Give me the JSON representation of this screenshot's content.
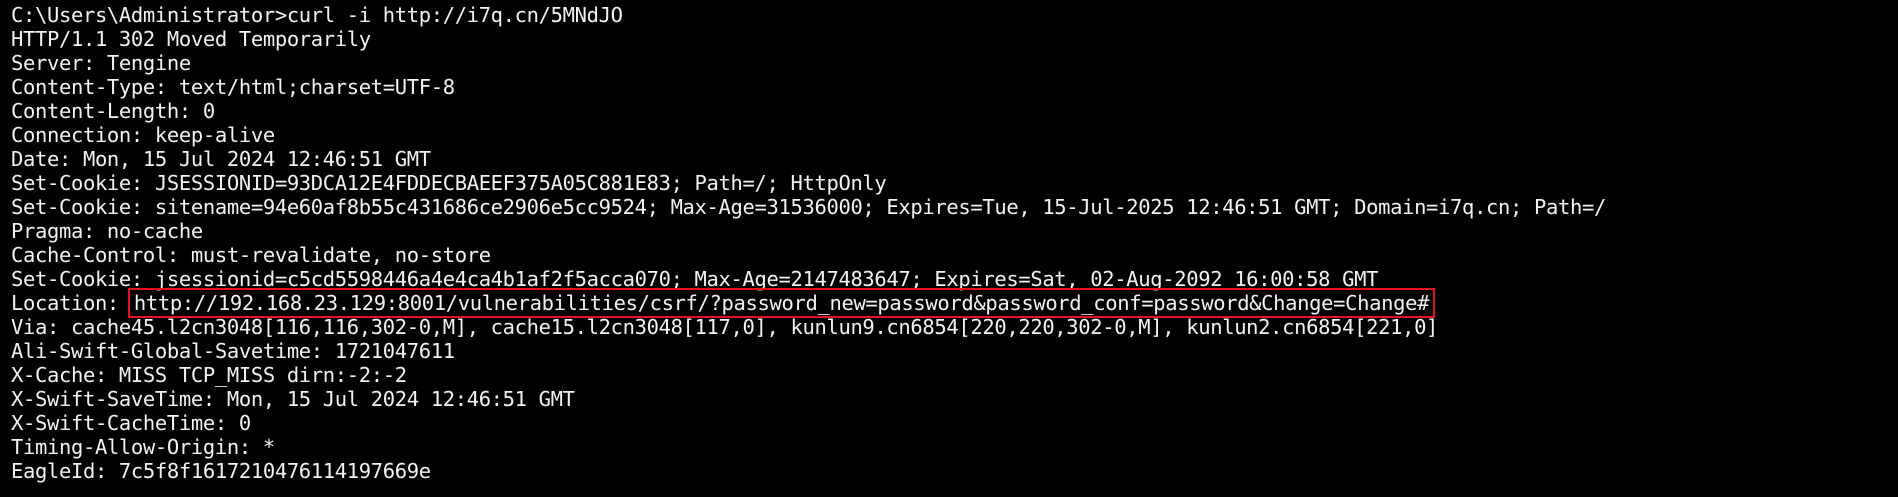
{
  "terminal": {
    "prompt_line": "C:\\Users\\Administrator>curl -i http://i7q.cn/5MNdJO",
    "status_line": "HTTP/1.1 302 Moved Temporarily",
    "headers_before_location": [
      "Server: Tengine",
      "Content-Type: text/html;charset=UTF-8",
      "Content-Length: 0",
      "Connection: keep-alive",
      "Date: Mon, 15 Jul 2024 12:46:51 GMT",
      "Set-Cookie: JSESSIONID=93DCA12E4FDDECBAEEF375A05C881E83; Path=/; HttpOnly",
      "Set-Cookie: sitename=94e60af8b55c431686ce2906e5cc9524; Max-Age=31536000; Expires=Tue, 15-Jul-2025 12:46:51 GMT; Domain=i7q.cn; Path=/",
      "Pragma: no-cache",
      "Cache-Control: must-revalidate, no-store",
      "Set-Cookie: jsessionid=c5cd5598446a4e4ca4b1af2f5acca070; Max-Age=2147483647; Expires=Sat, 02-Aug-2092 16:00:58 GMT"
    ],
    "location_label": "Location: ",
    "location_url": "http://192.168.23.129:8001/vulnerabilities/csrf/?password_new=password&password_conf=password&Change=Change#",
    "headers_after_location": [
      "Via: cache45.l2cn3048[116,116,302-0,M], cache15.l2cn3048[117,0], kunlun9.cn6854[220,220,302-0,M], kunlun2.cn6854[221,0]",
      "Ali-Swift-Global-Savetime: 1721047611",
      "X-Cache: MISS TCP_MISS dirn:-2:-2",
      "X-Swift-SaveTime: Mon, 15 Jul 2024 12:46:51 GMT",
      "X-Swift-CacheTime: 0",
      "Timing-Allow-Origin: *",
      "EagleId: 7c5f8f1617210476114197669e"
    ],
    "colors": {
      "background": "#000000",
      "foreground": "#f2f2f2",
      "highlight_box": "#e8121d"
    }
  }
}
